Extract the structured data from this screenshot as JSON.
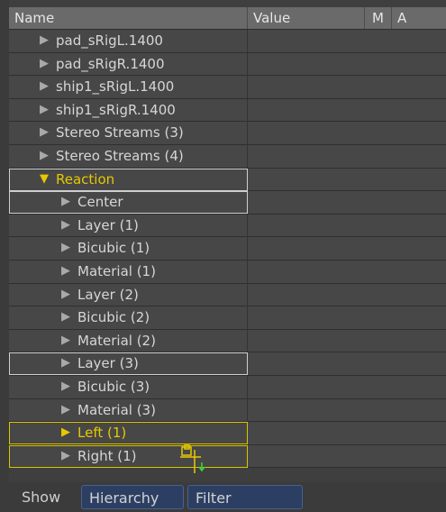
{
  "header": {
    "name": "Name",
    "value": "Value",
    "m": "M",
    "a": "A"
  },
  "rows": [
    {
      "label": "pad_sRigL.1400"
    },
    {
      "label": "pad_sRigR.1400"
    },
    {
      "label": "ship1_sRigL.1400"
    },
    {
      "label": "ship1_sRigR.1400"
    },
    {
      "label": "Stereo Streams (3)"
    },
    {
      "label": "Stereo Streams (4)"
    },
    {
      "label": "Reaction"
    },
    {
      "label": "Center"
    },
    {
      "label": "Layer (1)"
    },
    {
      "label": "Bicubic (1)"
    },
    {
      "label": "Material (1)"
    },
    {
      "label": "Layer (2)"
    },
    {
      "label": "Bicubic (2)"
    },
    {
      "label": "Material (2)"
    },
    {
      "label": "Layer (3)"
    },
    {
      "label": "Bicubic (3)"
    },
    {
      "label": "Material (3)"
    },
    {
      "label": "Left (1)"
    },
    {
      "label": "Right (1)"
    }
  ],
  "footer": {
    "show_label": "Show",
    "hierarchy_button": "Hierarchy",
    "filter_button": "Filter"
  },
  "colors": {
    "accent_yellow": "#e8c800",
    "button_blue": "#2c3f63"
  }
}
